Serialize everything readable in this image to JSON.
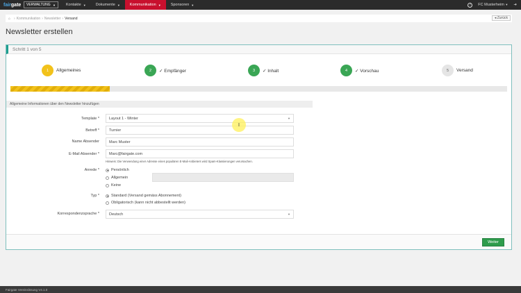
{
  "topbar": {
    "brand_prefix": "fair",
    "brand_suffix": "gate",
    "mode_select": "VERWALTUNG",
    "nav": [
      {
        "label": "Kontakte"
      },
      {
        "label": "Dokumente"
      },
      {
        "label": "Kommunikation"
      },
      {
        "label": "Sponsoren"
      }
    ],
    "active_nav": "Kommunikation",
    "help_label": "?",
    "club_name": "FC Musterheim",
    "logout_icon": "logout-icon"
  },
  "breadcrumb": {
    "items": [
      "Kommunikation",
      "Newsletter",
      "Versand"
    ],
    "back_label": "Zurück"
  },
  "page": {
    "title": "Newsletter erstellen"
  },
  "wizard": {
    "header": "Schritt 1 von 5",
    "steps": [
      {
        "number": "1",
        "label": "Allgemeines",
        "status": "current"
      },
      {
        "number": "2",
        "label": "✓ Empfänger",
        "status": "done"
      },
      {
        "number": "3",
        "label": "✓ Inhalt",
        "status": "done"
      },
      {
        "number": "4",
        "label": "✓ Vorschau",
        "status": "done"
      },
      {
        "number": "5",
        "label": "Versand",
        "status": "todo"
      }
    ],
    "progress_fraction": 0.2,
    "colors": {
      "current": "#f2c21b",
      "done": "#3aa655",
      "todo": "#e5e5e5"
    }
  },
  "form": {
    "section_title": "Allgemeine Informationen über den Newsletter hinzufügen",
    "template": {
      "label": "Template *",
      "value": "Layout 1 - Winter"
    },
    "betreff": {
      "label": "Betreff *",
      "value": "Turnier"
    },
    "name_absender": {
      "label": "Name Absender",
      "value": "Marc Muster"
    },
    "email_absender": {
      "label": "E-Mail Absender *",
      "value": "Marc@fairgate.com"
    },
    "email_hint": "Hinweis: Die Verwendung einer Adresse eines populären E-Mail-Anbieters wird Spam-Klassierungen verursachen.",
    "anrede": {
      "label": "Anrede *",
      "options": [
        "Persönlich",
        "Allgemein",
        "Keine"
      ],
      "selected": "Persönlich"
    },
    "typ": {
      "label": "Typ *",
      "options": [
        "Standard (Versand gemäss Abonnement)",
        "Obligatorisch (kann nicht abbestellt werden)"
      ],
      "selected": "Standard (Versand gemäss Abonnement)"
    },
    "korrespondenzsprache": {
      "label": "Korrespondenzsprache *",
      "value": "Deutsch"
    },
    "next_label": "Weiter"
  },
  "cursor": {
    "glyph": "I"
  },
  "footer": {
    "text": "Fairgate Vereinslösung V4.1.0"
  }
}
